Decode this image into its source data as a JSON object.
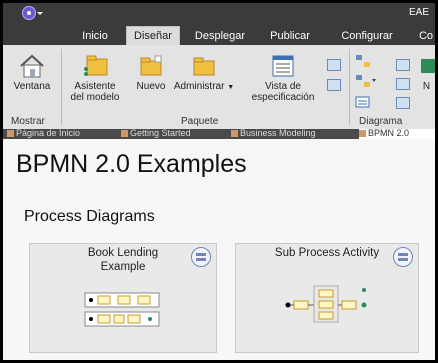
{
  "window": {
    "title": "EAE"
  },
  "tabs": [
    {
      "label": "Inicio",
      "active": false
    },
    {
      "label": "Diseñar",
      "active": true
    },
    {
      "label": "Desplegar",
      "active": false
    },
    {
      "label": "Publicar",
      "active": false
    },
    {
      "label": "Configurar",
      "active": false
    },
    {
      "label": "Co",
      "active": false
    }
  ],
  "ribbon": {
    "ventana": "Ventana",
    "asistente_line1": "Asistente",
    "asistente_line2": "del modelo",
    "nuevo": "Nuevo",
    "administrar": "Administrar",
    "vista_line1": "Vista de",
    "vista_line2": "especificación",
    "n_trunc": "N",
    "groups": {
      "mostrar": "Mostrar",
      "paquete": "Paquete",
      "diagrama": "Diagrama"
    }
  },
  "doc_tabs": [
    "Página de Inicio",
    "Getting Started",
    "Business Modeling",
    "BPMN 2.0"
  ],
  "page": {
    "title": "BPMN 2.0 Examples",
    "section": "Process Diagrams",
    "cards": [
      {
        "title_line1": "Book Lending",
        "title_line2": "Example"
      },
      {
        "title_line1": "Sub Process Activity",
        "title_line2": ""
      }
    ]
  },
  "colors": {
    "chrome": "#3b3b3b",
    "ribbon": "#e3e3e3",
    "accent": "#f0c040"
  }
}
